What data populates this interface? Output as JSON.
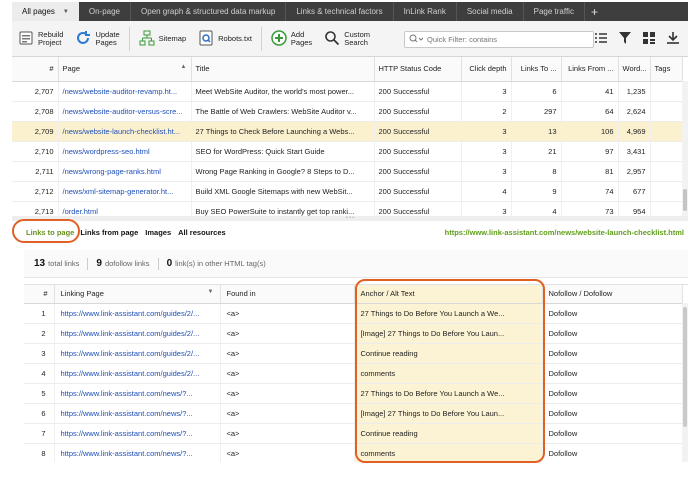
{
  "tabs": [
    {
      "label": "All pages",
      "active": true
    },
    {
      "label": "On-page",
      "active": false
    },
    {
      "label": "Open graph & structured data markup",
      "active": false
    },
    {
      "label": "Links & technical factors",
      "active": false
    },
    {
      "label": "InLink Rank",
      "active": false
    },
    {
      "label": "Social media",
      "active": false
    },
    {
      "label": "Page traffic",
      "active": false
    }
  ],
  "toolbar": {
    "rebuild_line1": "Rebuild",
    "rebuild_line2": "Project",
    "update_line1": "Update",
    "update_line2": "Pages",
    "sitemap": "Sitemap",
    "robots": "Robots.txt",
    "add_line1": "Add",
    "add_line2": "Pages",
    "search_line1": "Custom",
    "search_line2": "Search",
    "filter_placeholder": "Quick Filter: contains"
  },
  "upper_table": {
    "columns": [
      "#",
      "Page",
      "Title",
      "HTTP Status Code",
      "Click depth",
      "Links To ...",
      "Links From ...",
      "Word...",
      "Tags"
    ],
    "rows": [
      {
        "n": "2,707",
        "page": "/news/website-auditor-revamp.ht...",
        "title": "Meet WebSite Auditor, the world's most power...",
        "status": "200 Successful",
        "depth": "3",
        "links_to": "6",
        "links_from": "41",
        "words": "1,235",
        "tags": "",
        "selected": false
      },
      {
        "n": "2,708",
        "page": "/news/website-auditor-versus-scre...",
        "title": "The Battle of Web Crawlers: WebSite Auditor v...",
        "status": "200 Successful",
        "depth": "2",
        "links_to": "297",
        "links_from": "64",
        "words": "2,624",
        "tags": "",
        "selected": false
      },
      {
        "n": "2,709",
        "page": "/news/website-launch-checklist.ht...",
        "title": "27 Things to Check Before Launching a Webs...",
        "status": "200 Successful",
        "depth": "3",
        "links_to": "13",
        "links_from": "106",
        "words": "4,969",
        "tags": "",
        "selected": true
      },
      {
        "n": "2,710",
        "page": "/news/wordpress-seo.html",
        "title": "SEO for WordPress: Quick Start Guide",
        "status": "200 Successful",
        "depth": "3",
        "links_to": "21",
        "links_from": "97",
        "words": "3,431",
        "tags": "",
        "selected": false
      },
      {
        "n": "2,711",
        "page": "/news/wrong-page-ranks.html",
        "title": "Wrong Page Ranking in Google? 8 Steps to D...",
        "status": "200 Successful",
        "depth": "3",
        "links_to": "8",
        "links_from": "81",
        "words": "2,957",
        "tags": "",
        "selected": false
      },
      {
        "n": "2,712",
        "page": "/news/xml-sitemap-generator.ht...",
        "title": "Build XML Google Sitemaps with new WebSit...",
        "status": "200 Successful",
        "depth": "4",
        "links_to": "9",
        "links_from": "74",
        "words": "677",
        "tags": "",
        "selected": false
      },
      {
        "n": "2,713",
        "page": "/order.html",
        "title": "Buy SEO PowerSuite to instantly get top ranki...",
        "status": "200 Successful",
        "depth": "3",
        "links_to": "4",
        "links_from": "73",
        "words": "954",
        "tags": "",
        "selected": false
      }
    ]
  },
  "subtabs": {
    "links_to_page": "Links to page",
    "links_from_page": "Links from page",
    "images": "Images",
    "all_resources": "All resources",
    "page_url": "https://www.link-assistant.com/news/website-launch-checklist.html"
  },
  "summary": {
    "total_count": "13",
    "total_label": "total links",
    "dofollow_count": "9",
    "dofollow_label": "dofollow links",
    "other_count": "0",
    "other_label": "link(s) in other HTML tag(s)"
  },
  "lower_table": {
    "columns": [
      "#",
      "Linking Page",
      "Found in",
      "Anchor / Alt Text",
      "Nofollow / Dofollow"
    ],
    "rows": [
      {
        "n": "1",
        "page": "https://www.link-assistant.com/guides/2/...",
        "found": "<a>",
        "anchor": "27 Things to Do Before You Launch a We...",
        "follow": "Dofollow"
      },
      {
        "n": "2",
        "page": "https://www.link-assistant.com/guides/2/...",
        "found": "<a>",
        "anchor": "[Image] 27 Things to Do Before You Laun...",
        "follow": "Dofollow"
      },
      {
        "n": "3",
        "page": "https://www.link-assistant.com/guides/2/...",
        "found": "<a>",
        "anchor": "Continue reading",
        "follow": "Dofollow"
      },
      {
        "n": "4",
        "page": "https://www.link-assistant.com/guides/2/...",
        "found": "<a>",
        "anchor": "comments",
        "follow": "Dofollow"
      },
      {
        "n": "5",
        "page": "https://www.link-assistant.com/news/?...",
        "found": "<a>",
        "anchor": "27 Things to Do Before You Launch a We...",
        "follow": "Dofollow"
      },
      {
        "n": "6",
        "page": "https://www.link-assistant.com/news/?...",
        "found": "<a>",
        "anchor": "[Image] 27 Things to Do Before You Laun...",
        "follow": "Dofollow"
      },
      {
        "n": "7",
        "page": "https://www.link-assistant.com/news/?...",
        "found": "<a>",
        "anchor": "Continue reading",
        "follow": "Dofollow"
      },
      {
        "n": "8",
        "page": "https://www.link-assistant.com/news/?...",
        "found": "<a>",
        "anchor": "comments",
        "follow": "Dofollow"
      }
    ]
  },
  "colors": {
    "accent_green": "#6a8f1e",
    "highlight_ring": "#e06025",
    "selected_row": "#fbf1cf",
    "link_blue": "#1d4fb8"
  }
}
